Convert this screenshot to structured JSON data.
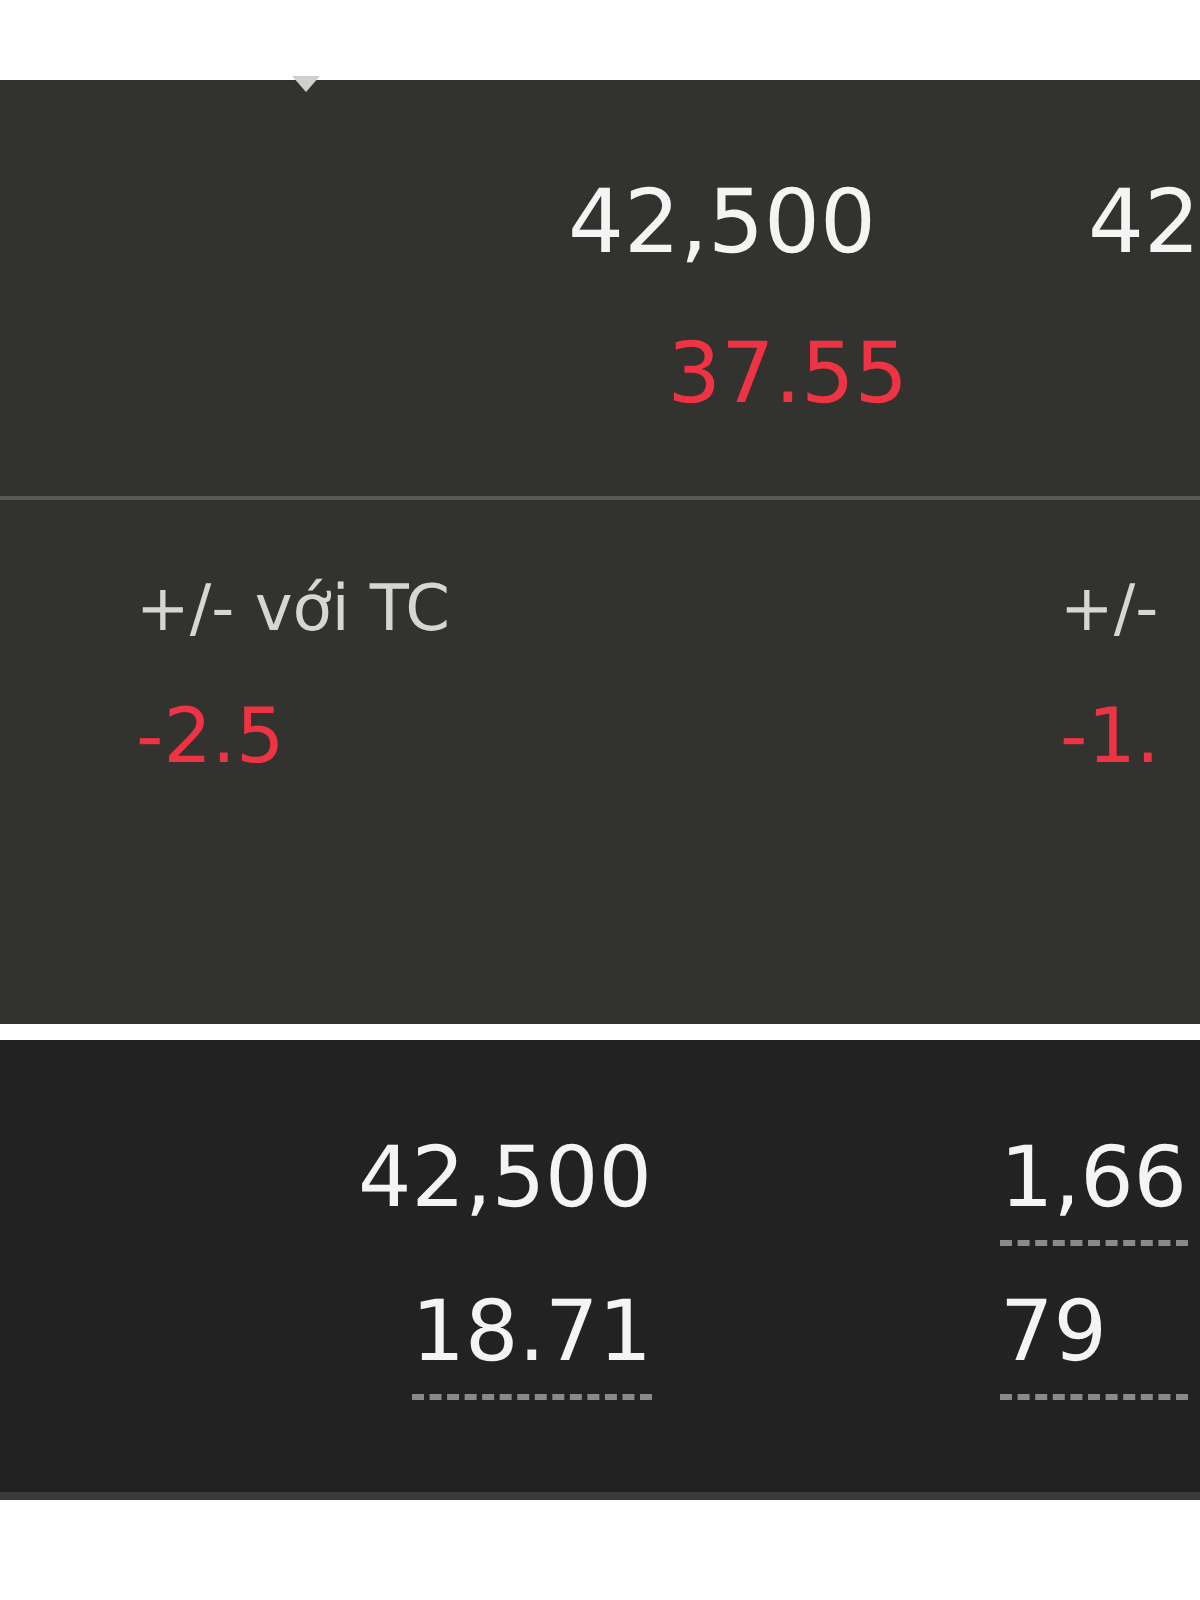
{
  "quote_panel": {
    "columns": [
      {
        "price": "42,500",
        "change": "37.55"
      },
      {
        "price": "42"
      }
    ]
  },
  "change_panel": {
    "items": [
      {
        "label": "+/- với TC",
        "value": "-2.5"
      },
      {
        "label": "+/-",
        "value": "-1."
      }
    ]
  },
  "summary_panel": {
    "columns": [
      {
        "cells": [
          {
            "text": "42,500",
            "underlined": false
          },
          {
            "text": "18.71",
            "underlined": true
          }
        ]
      },
      {
        "cells": [
          {
            "text": "1,66",
            "underlined": true
          },
          {
            "text": "79",
            "underlined": true
          }
        ]
      }
    ]
  }
}
